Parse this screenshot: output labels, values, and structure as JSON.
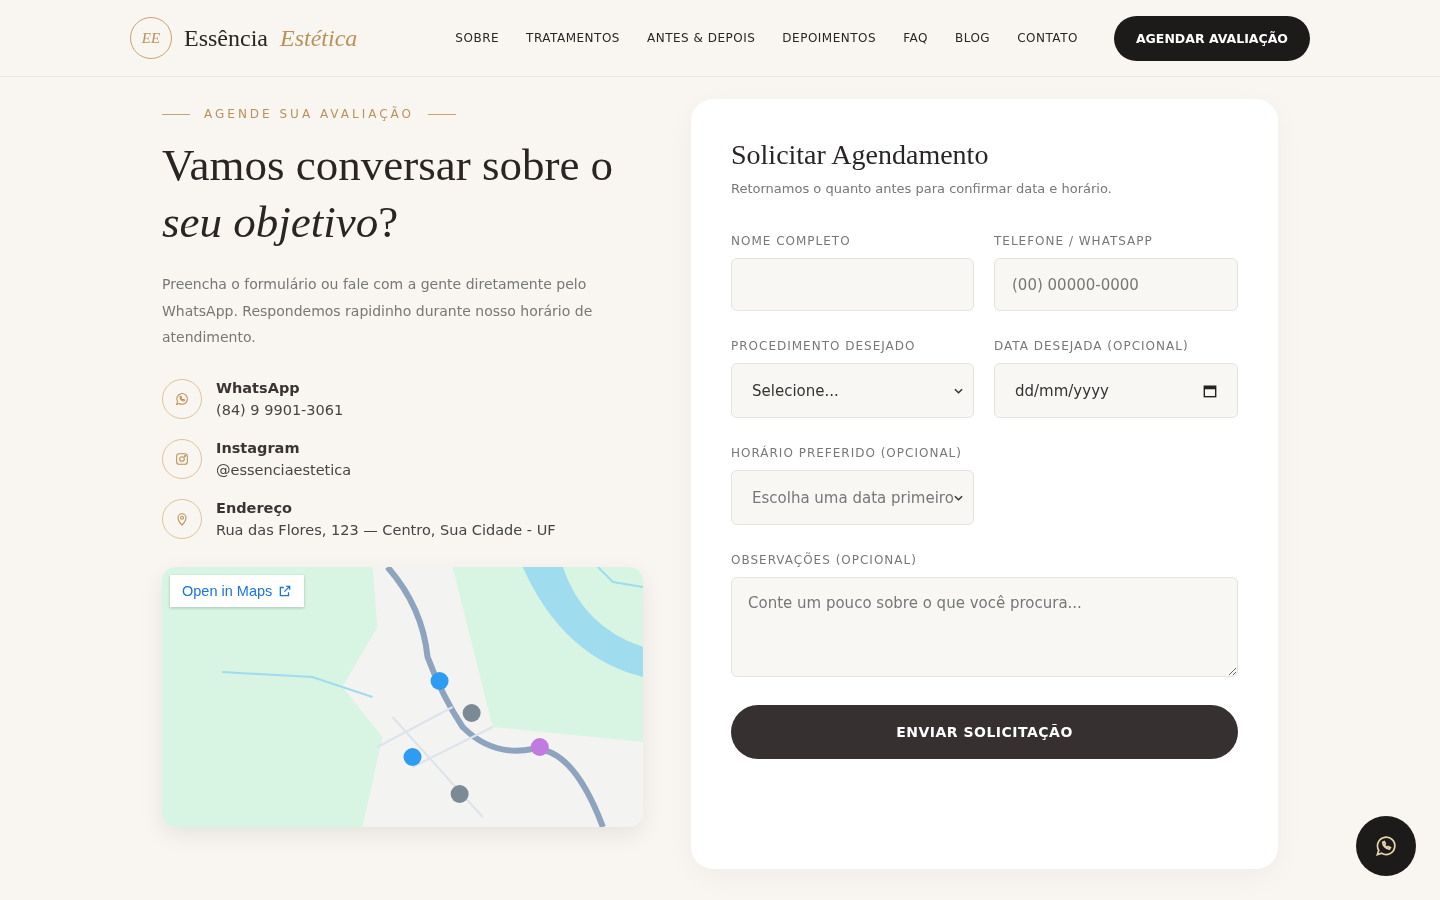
{
  "header": {
    "logo_mark": "EE",
    "brand": "Essência",
    "brand_accent": "Estética",
    "nav": [
      {
        "label": "SOBRE"
      },
      {
        "label": "TRATAMENTOS"
      },
      {
        "label": "ANTES & DEPOIS"
      },
      {
        "label": "DEPOIMENTOS"
      },
      {
        "label": "FAQ"
      },
      {
        "label": "BLOG"
      },
      {
        "label": "CONTATO"
      }
    ],
    "cta": "AGENDAR AVALIAÇÃO"
  },
  "intro": {
    "eyebrow": "AGENDE SUA AVALIAÇÃO",
    "title": "Vamos conversar sobre o *seu objetivo*?",
    "text": "Preencha o formulário ou fale com a gente diretamente pelo WhatsApp. Respondemos rapidinho durante nosso horário de atendimento."
  },
  "contacts": [
    {
      "kind": "whatsapp",
      "label": "WhatsApp",
      "value": "(84) 9 9901-3061"
    },
    {
      "kind": "instagram",
      "label": "Instagram",
      "value": "@essenciaestetica"
    },
    {
      "kind": "address",
      "label": "Endereço",
      "value": "Rua das Flores, 123 — Centro, Sua Cidade - UF"
    }
  ],
  "map": {
    "kind": "picture",
    "open_link": "Open in Maps"
  },
  "form": {
    "title": "Solicitar Agendamento",
    "subtitle": "Retornamos o quanto antes para confirmar data e horário.",
    "fields": [
      {
        "kind": "text",
        "label": "NOME COMPLETO"
      },
      {
        "kind": "text",
        "label": "TELEFONE / WHATSAPP",
        "placeholder": "(00) 00000-0000"
      },
      {
        "kind": "select",
        "label": "PROCEDIMENTO DESEJADO",
        "value": "Selecione..."
      },
      {
        "kind": "date",
        "label": "DATA DESEJADA (OPCIONAL)",
        "value": "dd/mm/yyyy"
      },
      {
        "kind": "select",
        "label": "HORÁRIO PREFERIDO (OPCIONAL)",
        "placeholder": "Escolha uma data primeiro"
      },
      {
        "kind": "textarea",
        "label": "OBSERVAÇÕES (OPCIONAL)",
        "placeholder": "Conte um pouco sobre o que você procura..."
      }
    ],
    "submit": "ENVIAR SOLICITAÇÃO"
  }
}
